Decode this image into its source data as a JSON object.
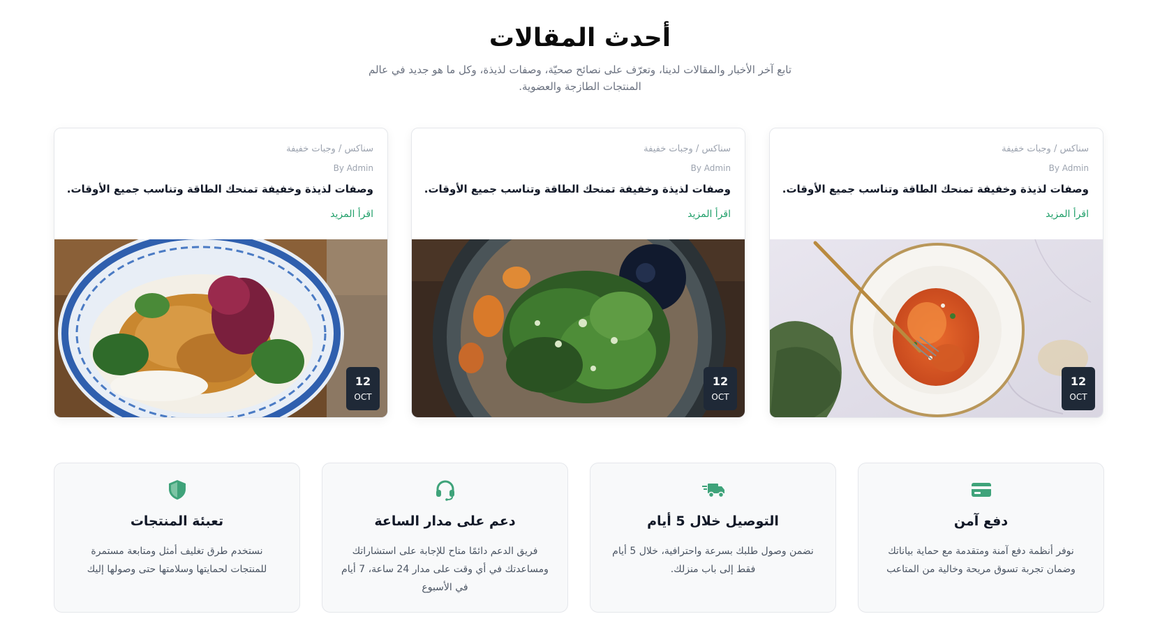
{
  "section": {
    "title": "أحدث المقالات",
    "subtitle": "تابع آخر الأخبار والمقالات لدينا، وتعرّف على نصائح صحيّة، وصفات لذيذة، وكل ما هو جديد في عالم المنتجات الطازجة والعضوية."
  },
  "articles": [
    {
      "category": "سناكس / وجبات خفيفة",
      "author": "By Admin",
      "title": "وصفات لذيذة وخفيفة تمنحك الطاقة وتناسب جميع الأوقات.",
      "read_more": "اقرأ المزيد",
      "image": "pasta-plate-image",
      "date_day": "12",
      "date_month": "OCT"
    },
    {
      "category": "سناكس / وجبات خفيفة",
      "author": "By Admin",
      "title": "وصفات لذيذة وخفيفة تمنحك الطاقة وتناسب جميع الأوقات.",
      "read_more": "اقرأ المزيد",
      "image": "noodle-greens-bowl-image",
      "date_day": "12",
      "date_month": "OCT"
    },
    {
      "category": "سناكس / وجبات خفيفة",
      "author": "By Admin",
      "title": "وصفات لذيذة وخفيفة تمنحك الطاقة وتناسب جميع الأوقات.",
      "read_more": "اقرأ المزيد",
      "image": "rice-bowl-image",
      "date_day": "12",
      "date_month": "OCT"
    }
  ],
  "features": [
    {
      "icon": "credit-card-icon",
      "title": "دفع آمن",
      "description": "نوفر أنظمة دفع آمنة ومتقدمة مع حماية بياناتك وضمان تجربة تسوق مريحة وخالية من المتاعب"
    },
    {
      "icon": "delivery-truck-icon",
      "title": "التوصيل خلال 5 أيام",
      "description": "نضمن وصول طلبك بسرعة واحترافية، خلال 5 أيام فقط إلى باب منزلك."
    },
    {
      "icon": "headset-icon",
      "title": "دعم على مدار الساعة",
      "description": "فريق الدعم دائمًا متاح للإجابة على استشاراتك ومساعدتك في أي وقت على مدار 24 ساعة، 7 أيام في الأسبوع"
    },
    {
      "icon": "shield-icon",
      "title": "تعبئة المنتجات",
      "description": "نستخدم طرق تغليف أمثل ومتابعة مستمرة للمنتجات لحمايتها وسلامتها حتى وصولها إليك"
    }
  ],
  "colors": {
    "accent": "#22a06b",
    "badge": "#1f2937",
    "feature_icon": "#3fa37a"
  }
}
